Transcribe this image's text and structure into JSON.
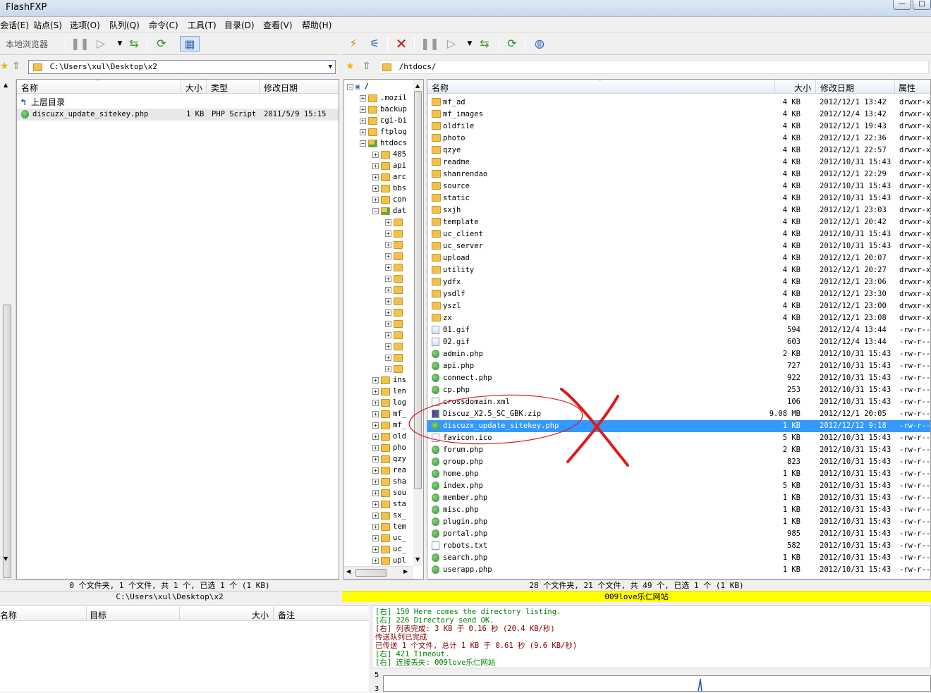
{
  "window": {
    "title": "FlashFXP",
    "min": "—",
    "max": "□"
  },
  "menu": [
    "会话(E)",
    "站点(S)",
    "选项(O)",
    "队列(Q)",
    "命令(C)",
    "工具(T)",
    "目录(D)",
    "查看(V)",
    "帮助(H)"
  ],
  "left": {
    "toolbar_label": "本地浏览器",
    "path": "C:\\Users\\xul\\Desktop\\x2",
    "columns": {
      "name": "名称",
      "size": "大小",
      "type": "类型",
      "date": "修改日期"
    },
    "parent": "上层目录",
    "files": [
      {
        "name": "discuzx_update_sitekey.php",
        "size": "1 KB",
        "type": "PHP Script",
        "date": "2011/5/9 15:15"
      }
    ],
    "status1": "0 个文件夹, 1 个文件, 共 1 个, 已选 1 个 (1 KB)",
    "status2": "C:\\Users\\xul\\Desktop\\x2"
  },
  "right": {
    "path": "/htdocs/",
    "columns": {
      "name": "名称",
      "size": "大小",
      "date": "修改日期",
      "attr": "属性"
    },
    "tree_root": "/",
    "tree_top": [
      ".mozil",
      "backup",
      "cgi-bi",
      "ftplog",
      "htdocs"
    ],
    "tree_sub": [
      "405",
      "api",
      "arc",
      "bbs",
      "con",
      "dat"
    ],
    "tree_sub2": [
      "ins",
      "len",
      "log",
      "mf_",
      "mf_",
      "old",
      "pho",
      "qzy",
      "rea",
      "sha",
      "sou",
      "sta",
      "sx_",
      "tem",
      "uc_",
      "uc_",
      "upl"
    ],
    "files": [
      {
        "kind": "dir",
        "name": "mf_ad",
        "size": "4 KB",
        "date": "2012/12/1 13:42",
        "attr": "drwxr-xr"
      },
      {
        "kind": "dir",
        "name": "mf_images",
        "size": "4 KB",
        "date": "2012/12/4 13:42",
        "attr": "drwxr-xr"
      },
      {
        "kind": "dir",
        "name": "oldfile",
        "size": "4 KB",
        "date": "2012/12/1 19:43",
        "attr": "drwxr-xr"
      },
      {
        "kind": "dir",
        "name": "photo",
        "size": "4 KB",
        "date": "2012/12/1 22:36",
        "attr": "drwxr-xr"
      },
      {
        "kind": "dir",
        "name": "qzye",
        "size": "4 KB",
        "date": "2012/12/1 22:57",
        "attr": "drwxr-xr"
      },
      {
        "kind": "dir",
        "name": "readme",
        "size": "4 KB",
        "date": "2012/10/31 15:43",
        "attr": "drwxr-xr"
      },
      {
        "kind": "dir",
        "name": "shanrendao",
        "size": "4 KB",
        "date": "2012/12/1 22:29",
        "attr": "drwxr-xr"
      },
      {
        "kind": "dir",
        "name": "source",
        "size": "4 KB",
        "date": "2012/10/31 15:43",
        "attr": "drwxr-xr"
      },
      {
        "kind": "dir",
        "name": "static",
        "size": "4 KB",
        "date": "2012/10/31 15:43",
        "attr": "drwxr-xr"
      },
      {
        "kind": "dir",
        "name": "sxjh",
        "size": "4 KB",
        "date": "2012/12/1 23:03",
        "attr": "drwxr-xr"
      },
      {
        "kind": "dir",
        "name": "template",
        "size": "4 KB",
        "date": "2012/12/1 20:42",
        "attr": "drwxr-xr"
      },
      {
        "kind": "dir",
        "name": "uc_client",
        "size": "4 KB",
        "date": "2012/10/31 15:43",
        "attr": "drwxr-xr"
      },
      {
        "kind": "dir",
        "name": "uc_server",
        "size": "4 KB",
        "date": "2012/10/31 15:43",
        "attr": "drwxr-xr"
      },
      {
        "kind": "dir",
        "name": "upload",
        "size": "4 KB",
        "date": "2012/12/1 20:07",
        "attr": "drwxr-xr"
      },
      {
        "kind": "dir",
        "name": "utility",
        "size": "4 KB",
        "date": "2012/12/1 20:27",
        "attr": "drwxr-xr"
      },
      {
        "kind": "dir",
        "name": "ydfx",
        "size": "4 KB",
        "date": "2012/12/1 23:06",
        "attr": "drwxr-xr"
      },
      {
        "kind": "dir",
        "name": "ysdlf",
        "size": "4 KB",
        "date": "2012/12/1 23:30",
        "attr": "drwxr-xr"
      },
      {
        "kind": "dir",
        "name": "yszl",
        "size": "4 KB",
        "date": "2012/12/1 23:00",
        "attr": "drwxr-xr"
      },
      {
        "kind": "dir",
        "name": "zx",
        "size": "4 KB",
        "date": "2012/12/1 23:08",
        "attr": "drwxr-xr"
      },
      {
        "kind": "img",
        "name": "01.gif",
        "size": "594",
        "date": "2012/12/4 13:44",
        "attr": "-rw-r--r"
      },
      {
        "kind": "img",
        "name": "02.gif",
        "size": "603",
        "date": "2012/12/4 13:44",
        "attr": "-rw-r--r"
      },
      {
        "kind": "php",
        "name": "admin.php",
        "size": "2 KB",
        "date": "2012/10/31 15:43",
        "attr": "-rw-r--r"
      },
      {
        "kind": "php",
        "name": "api.php",
        "size": "727",
        "date": "2012/10/31 15:43",
        "attr": "-rw-r--r"
      },
      {
        "kind": "php",
        "name": "connect.php",
        "size": "922",
        "date": "2012/10/31 15:43",
        "attr": "-rw-r--r"
      },
      {
        "kind": "php",
        "name": "cp.php",
        "size": "253",
        "date": "2012/10/31 15:43",
        "attr": "-rw-r--r"
      },
      {
        "kind": "file",
        "name": "crossdomain.xml",
        "size": "106",
        "date": "2012/10/31 15:43",
        "attr": "-rw-r--r"
      },
      {
        "kind": "zip",
        "name": "Discuz_X2.5_SC_GBK.zip",
        "size": "9.08 MB",
        "date": "2012/12/1 20:05",
        "attr": "-rw-r--r"
      },
      {
        "kind": "php",
        "name": "discuzx_update_sitekey.php",
        "size": "1 KB",
        "date": "2012/12/12 9:18",
        "attr": "-rw-r--r",
        "selected": true
      },
      {
        "kind": "file",
        "name": "favicon.ico",
        "size": "5 KB",
        "date": "2012/10/31 15:43",
        "attr": "-rw-r--r"
      },
      {
        "kind": "php",
        "name": "forum.php",
        "size": "2 KB",
        "date": "2012/10/31 15:43",
        "attr": "-rw-r--r"
      },
      {
        "kind": "php",
        "name": "group.php",
        "size": "823",
        "date": "2012/10/31 15:43",
        "attr": "-rw-r--r"
      },
      {
        "kind": "php",
        "name": "home.php",
        "size": "1 KB",
        "date": "2012/10/31 15:43",
        "attr": "-rw-r--r"
      },
      {
        "kind": "php",
        "name": "index.php",
        "size": "5 KB",
        "date": "2012/10/31 15:43",
        "attr": "-rw-r--r"
      },
      {
        "kind": "php",
        "name": "member.php",
        "size": "1 KB",
        "date": "2012/10/31 15:43",
        "attr": "-rw-r--r"
      },
      {
        "kind": "php",
        "name": "misc.php",
        "size": "1 KB",
        "date": "2012/10/31 15:43",
        "attr": "-rw-r--r"
      },
      {
        "kind": "php",
        "name": "plugin.php",
        "size": "1 KB",
        "date": "2012/10/31 15:43",
        "attr": "-rw-r--r"
      },
      {
        "kind": "php",
        "name": "portal.php",
        "size": "985",
        "date": "2012/10/31 15:43",
        "attr": "-rw-r--r"
      },
      {
        "kind": "file",
        "name": "robots.txt",
        "size": "582",
        "date": "2012/10/31 15:43",
        "attr": "-rw-r--r"
      },
      {
        "kind": "php",
        "name": "search.php",
        "size": "1 KB",
        "date": "2012/10/31 15:43",
        "attr": "-rw-r--r"
      },
      {
        "kind": "php",
        "name": "userapp.php",
        "size": "1 KB",
        "date": "2012/10/31 15:43",
        "attr": "-rw-r--r"
      }
    ],
    "status1": "28 个文件夹, 21 个文件, 共 49 个, 已选 1 个 (1 KB)",
    "status2": "009love乐仁网站"
  },
  "queue": {
    "columns": {
      "name": "名称",
      "target": "目标",
      "size": "大小",
      "note": "备注"
    }
  },
  "log": [
    {
      "text": "[右] 150 Here comes the directory listing.",
      "color": "#008000"
    },
    {
      "text": "[右] 226 Directory send OK.",
      "color": "#008000"
    },
    {
      "text": "[右] 列表完成: 3 KB 于 0.16 秒 (20.4 KB/秒)",
      "color": "#800000"
    },
    {
      "text": "传送队列已完成",
      "color": "#800000"
    },
    {
      "text": "已传送 1 个文件, 总计 1 KB 于 0.61 秒 (9.6 KB/秒)",
      "color": "#800000"
    },
    {
      "text": "[右] 421 Timeout.",
      "color": "#008000"
    },
    {
      "text": "[右] 连接丢失: 009love乐仁网站",
      "color": "#008000"
    }
  ],
  "graph": {
    "label_top": "5",
    "label_bottom": "3"
  },
  "colors": {
    "selection": "#3399ff",
    "status_yellow": "#ffff00",
    "annotation": "#e0191b"
  }
}
